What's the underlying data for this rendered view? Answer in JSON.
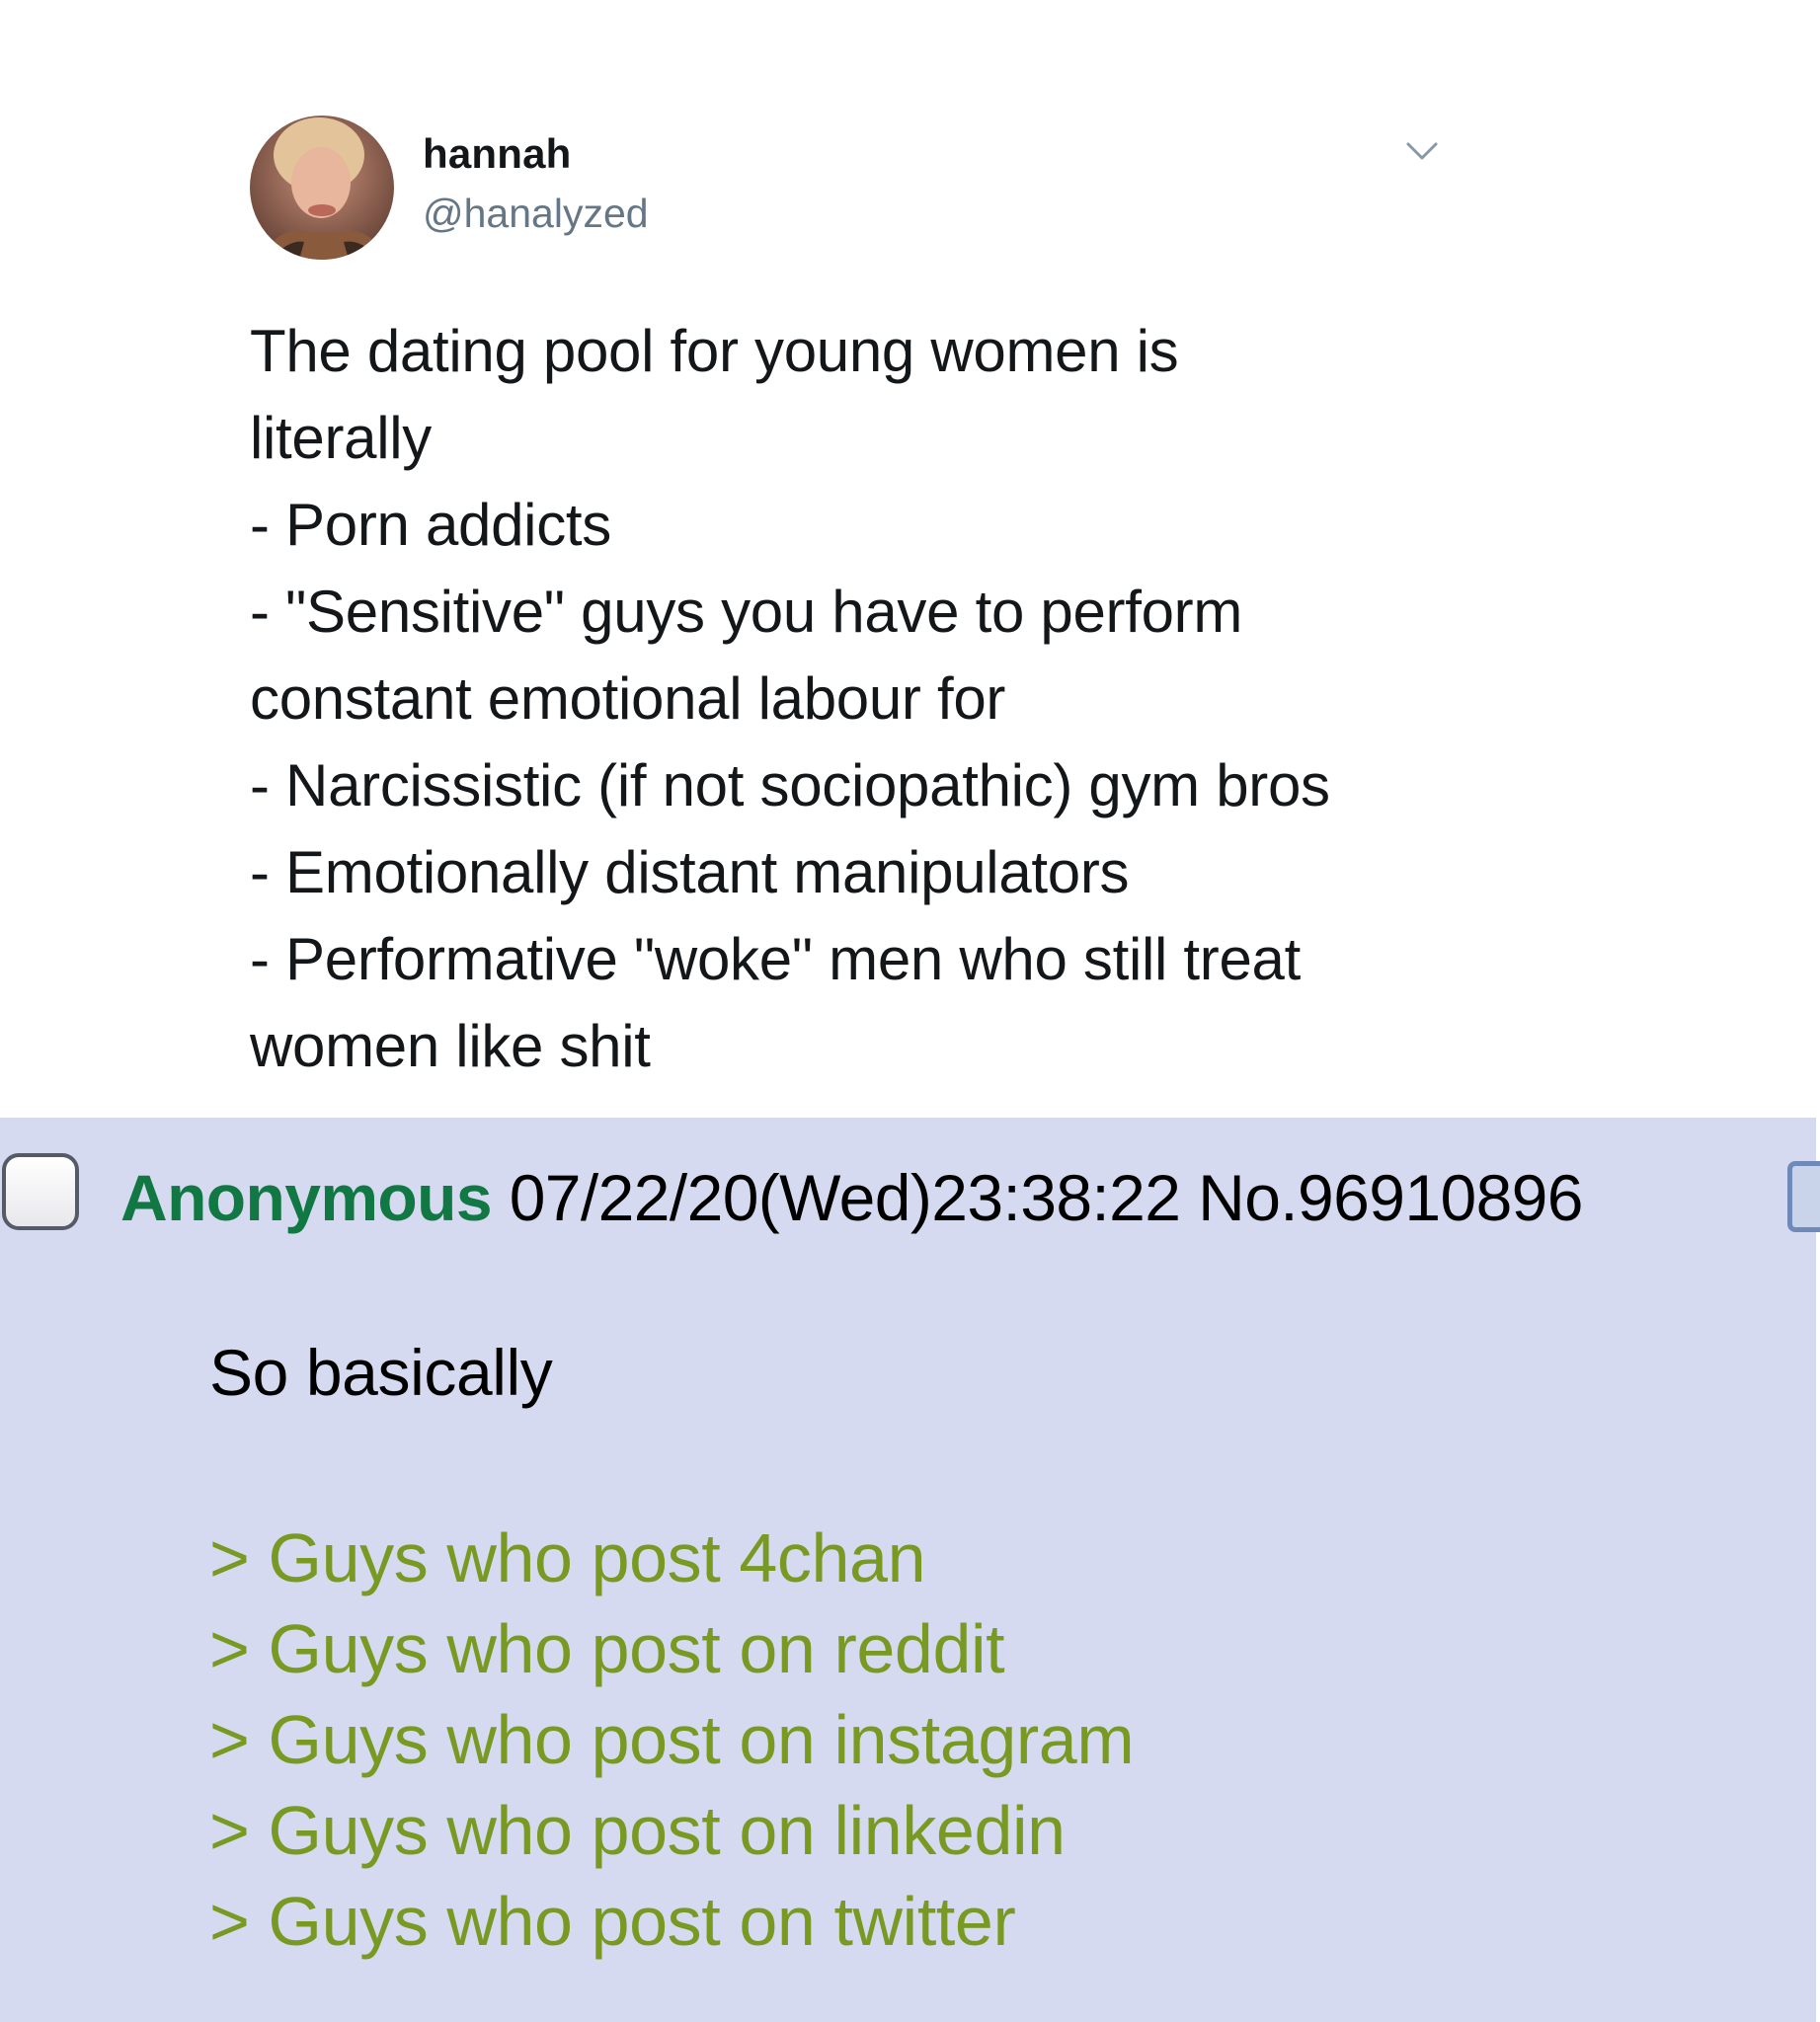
{
  "tweet": {
    "display_name": "hannah",
    "handle": "@hanalyzed",
    "menu_icon": "chevron-down-icon",
    "lines": [
      "The dating pool for young women is",
      "literally",
      "- Porn addicts",
      "- \"Sensitive\" guys you have to perform",
      "constant emotional labour for",
      "- Narcissistic (if not sociopathic) gym bros",
      "- Emotionally distant manipulators",
      "- Performative \"woke\" men who still treat",
      "women like shit"
    ]
  },
  "post": {
    "name": "Anonymous",
    "datetime": "07/22/20(Wed)23:38:22",
    "number": "No.96910896",
    "body": "So basically",
    "greentext": [
      "> Guys who post 4chan",
      "> Guys who post on reddit",
      "> Guys who post on instagram",
      "> Guys who post on linkedin",
      "> Guys who post on twitter"
    ]
  },
  "colors": {
    "post_background": "#d6daf0",
    "name_green": "#117743",
    "greentext": "#789922",
    "handle_gray": "#657786"
  }
}
